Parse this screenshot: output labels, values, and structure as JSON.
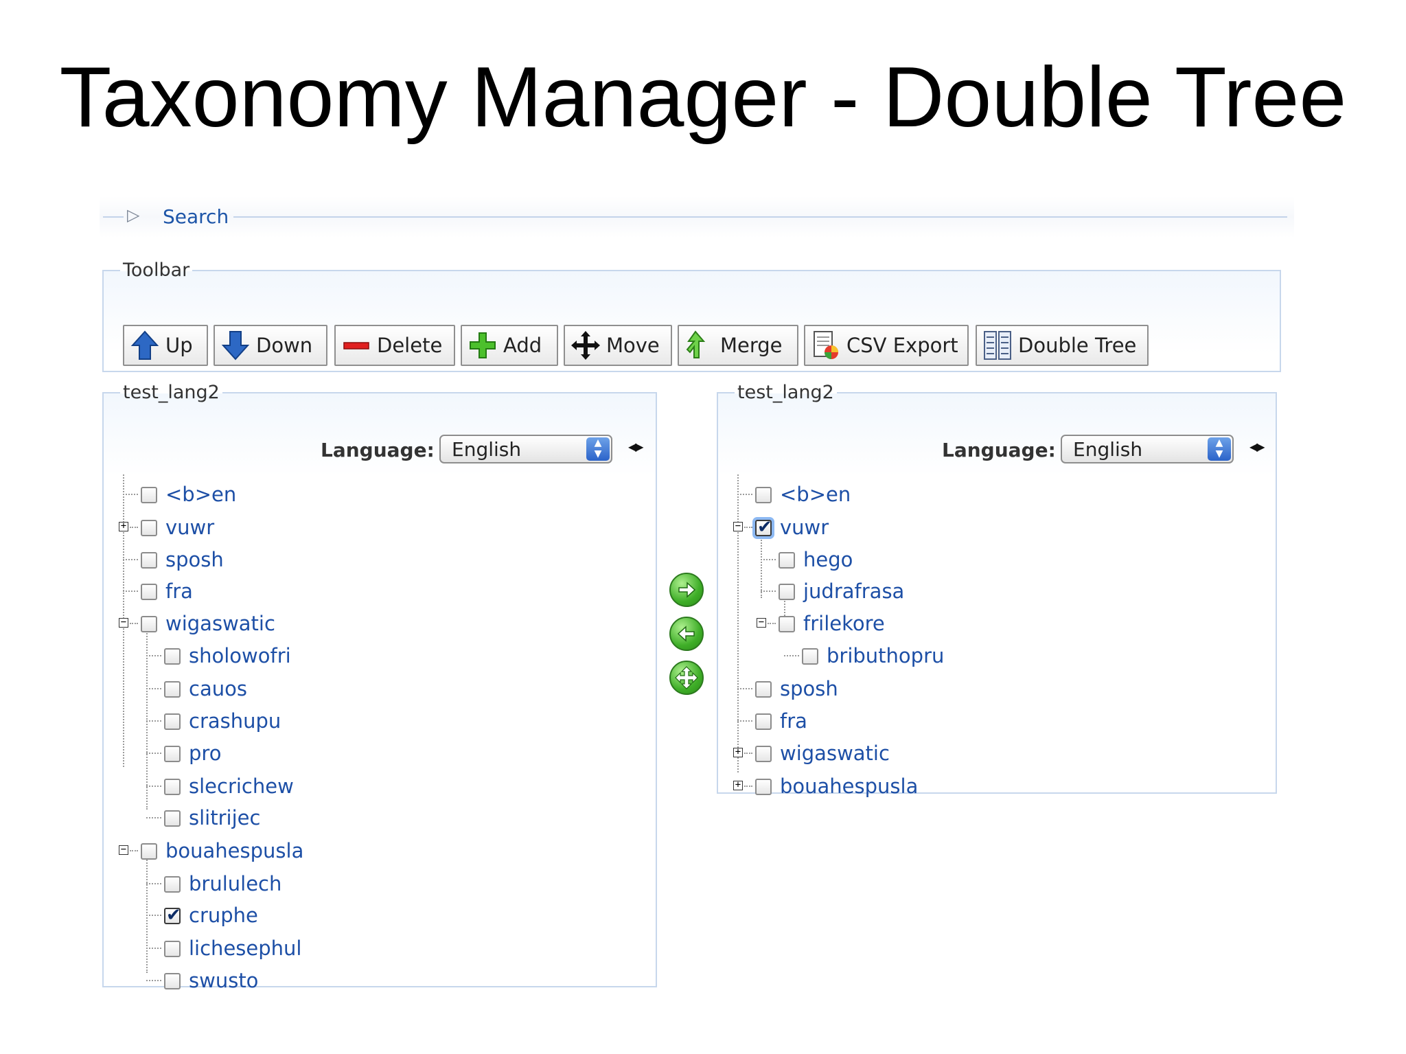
{
  "title": "Taxonomy Manager - Double Tree",
  "search": {
    "label": "Search"
  },
  "toolbar": {
    "legend": "Toolbar",
    "buttons": [
      {
        "label": "Up",
        "icon": "arrow-up-icon"
      },
      {
        "label": "Down",
        "icon": "arrow-down-icon"
      },
      {
        "label": "Delete",
        "icon": "minus-icon"
      },
      {
        "label": "Add",
        "icon": "plus-icon"
      },
      {
        "label": "Move",
        "icon": "move-icon"
      },
      {
        "label": "Merge",
        "icon": "merge-icon"
      },
      {
        "label": "CSV Export",
        "icon": "csv-export-icon"
      },
      {
        "label": "Double Tree",
        "icon": "double-tree-icon"
      }
    ]
  },
  "left_tree": {
    "legend": "test_lang2",
    "language_label": "Language:",
    "language_value": "English",
    "nodes": [
      {
        "label": "<b>en",
        "checked": false,
        "toggle": ""
      },
      {
        "label": "vuwr",
        "checked": false,
        "toggle": "+"
      },
      {
        "label": "sposh",
        "checked": false,
        "toggle": ""
      },
      {
        "label": "fra",
        "checked": false,
        "toggle": ""
      },
      {
        "label": "wigaswatic",
        "checked": false,
        "toggle": "-"
      },
      {
        "label": "sholowofri",
        "checked": false,
        "toggle": ""
      },
      {
        "label": "cauos",
        "checked": false,
        "toggle": ""
      },
      {
        "label": "crashupu",
        "checked": false,
        "toggle": ""
      },
      {
        "label": "pro",
        "checked": false,
        "toggle": ""
      },
      {
        "label": "slecrichew",
        "checked": false,
        "toggle": ""
      },
      {
        "label": "slitrijec",
        "checked": false,
        "toggle": ""
      },
      {
        "label": "bouahespusla",
        "checked": false,
        "toggle": "-"
      },
      {
        "label": "brululech",
        "checked": false,
        "toggle": ""
      },
      {
        "label": "cruphe",
        "checked": true,
        "toggle": ""
      },
      {
        "label": "lichesephul",
        "checked": false,
        "toggle": ""
      },
      {
        "label": "swusto",
        "checked": false,
        "toggle": ""
      }
    ]
  },
  "right_tree": {
    "legend": "test_lang2",
    "language_label": "Language:",
    "language_value": "English",
    "nodes": [
      {
        "label": "<b>en",
        "checked": false,
        "toggle": ""
      },
      {
        "label": "vuwr",
        "checked": true,
        "toggle": "-"
      },
      {
        "label": "hego",
        "checked": false,
        "toggle": ""
      },
      {
        "label": "judrafrasa",
        "checked": false,
        "toggle": ""
      },
      {
        "label": "frilekore",
        "checked": false,
        "toggle": "-"
      },
      {
        "label": "bributhopru",
        "checked": false,
        "toggle": ""
      },
      {
        "label": "sposh",
        "checked": false,
        "toggle": ""
      },
      {
        "label": "fra",
        "checked": false,
        "toggle": ""
      },
      {
        "label": "wigaswatic",
        "checked": false,
        "toggle": "+"
      },
      {
        "label": "bouahespusla",
        "checked": false,
        "toggle": "+"
      }
    ]
  },
  "transfer_buttons": [
    {
      "icon": "arrow-right-icon"
    },
    {
      "icon": "arrow-left-icon"
    },
    {
      "icon": "swap-icon"
    }
  ],
  "colors": {
    "link": "#1d4fa6",
    "border": "#c7d7ec",
    "accent_green": "#3fae28"
  }
}
